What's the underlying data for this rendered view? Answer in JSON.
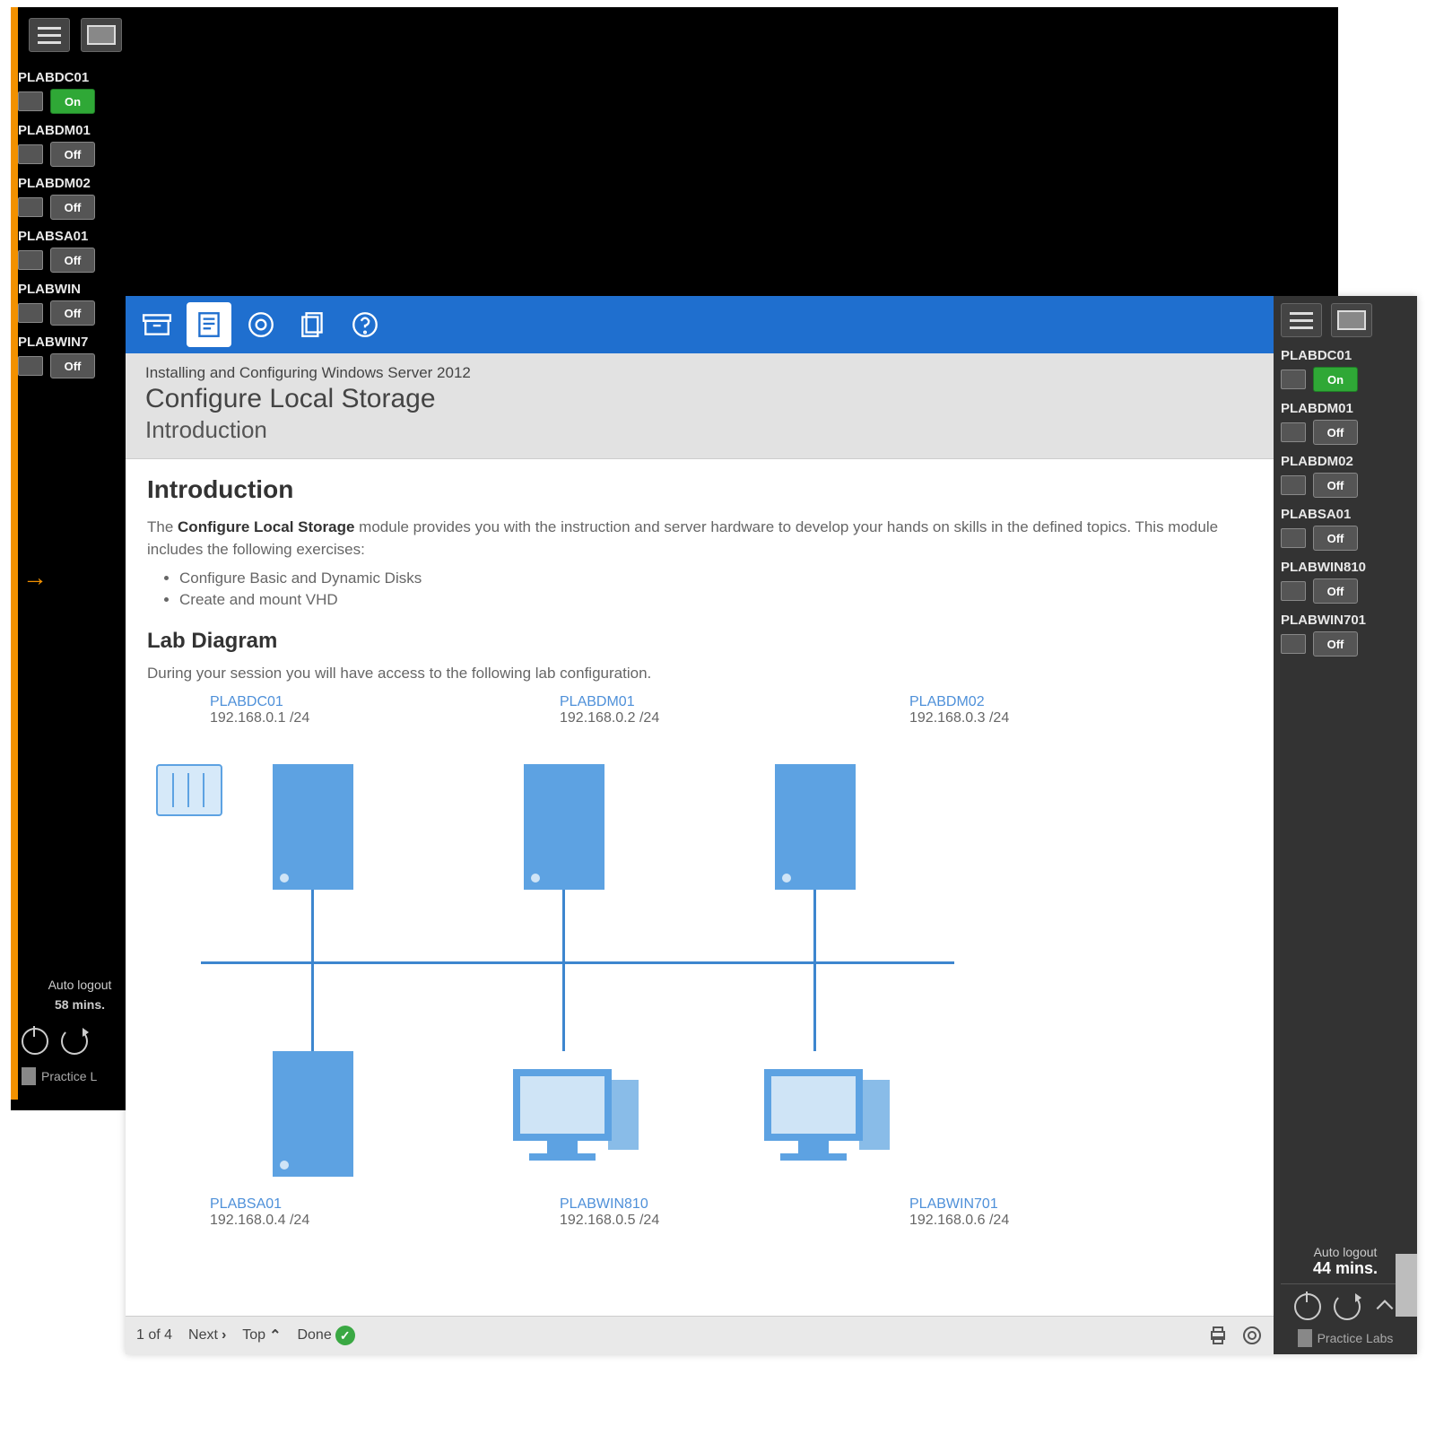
{
  "back": {
    "devices": [
      {
        "name": "PLABDC01",
        "status": "On",
        "status_class": "on"
      },
      {
        "name": "PLABDM01",
        "status": "Off",
        "status_class": "off"
      },
      {
        "name": "PLABDM02",
        "status": "Off",
        "status_class": "off"
      },
      {
        "name": "PLABSA01",
        "status": "Off",
        "status_class": "off"
      },
      {
        "name": "PLABWIN",
        "status": "Off",
        "status_class": "off"
      },
      {
        "name": "PLABWIN7",
        "status": "Off",
        "status_class": "off"
      }
    ],
    "auto_logout_label": "Auto logout",
    "auto_logout_value": "58 mins.",
    "brand": "Practice L"
  },
  "front": {
    "header": {
      "breadcrumb": "Installing and Configuring Windows Server 2012",
      "module": "Configure Local Storage",
      "section": "Introduction"
    },
    "content": {
      "heading": "Introduction",
      "intro_prefix": "The ",
      "intro_bold": "Configure Local Storage",
      "intro_suffix": " module provides you with the instruction and server hardware to develop your hands on skills in the defined topics. This module includes the following exercises:",
      "exercises": [
        "Configure Basic and Dynamic Disks",
        "Create and mount VHD"
      ],
      "lab_heading": "Lab Diagram",
      "lab_intro": "During your session you will have access to the following lab configuration.",
      "nodes_top": [
        {
          "name": "PLABDC01",
          "ip": "192.168.0.1 /24"
        },
        {
          "name": "PLABDM01",
          "ip": "192.168.0.2 /24"
        },
        {
          "name": "PLABDM02",
          "ip": "192.168.0.3 /24"
        }
      ],
      "nodes_bottom": [
        {
          "name": "PLABSA01",
          "ip": "192.168.0.4 /24"
        },
        {
          "name": "PLABWIN810",
          "ip": "192.168.0.5 /24"
        },
        {
          "name": "PLABWIN701",
          "ip": "192.168.0.6 /24"
        }
      ]
    },
    "bottom": {
      "page": "1 of 4",
      "next": "Next",
      "top": "Top",
      "done": "Done"
    },
    "sidebar": {
      "devices": [
        {
          "name": "PLABDC01",
          "status": "On",
          "status_class": "on"
        },
        {
          "name": "PLABDM01",
          "status": "Off",
          "status_class": "off"
        },
        {
          "name": "PLABDM02",
          "status": "Off",
          "status_class": "off"
        },
        {
          "name": "PLABSA01",
          "status": "Off",
          "status_class": "off"
        },
        {
          "name": "PLABWIN810",
          "status": "Off",
          "status_class": "off"
        },
        {
          "name": "PLABWIN701",
          "status": "Off",
          "status_class": "off"
        }
      ],
      "auto_logout_label": "Auto logout",
      "auto_logout_value": "44 mins.",
      "brand": "Practice Labs"
    }
  }
}
